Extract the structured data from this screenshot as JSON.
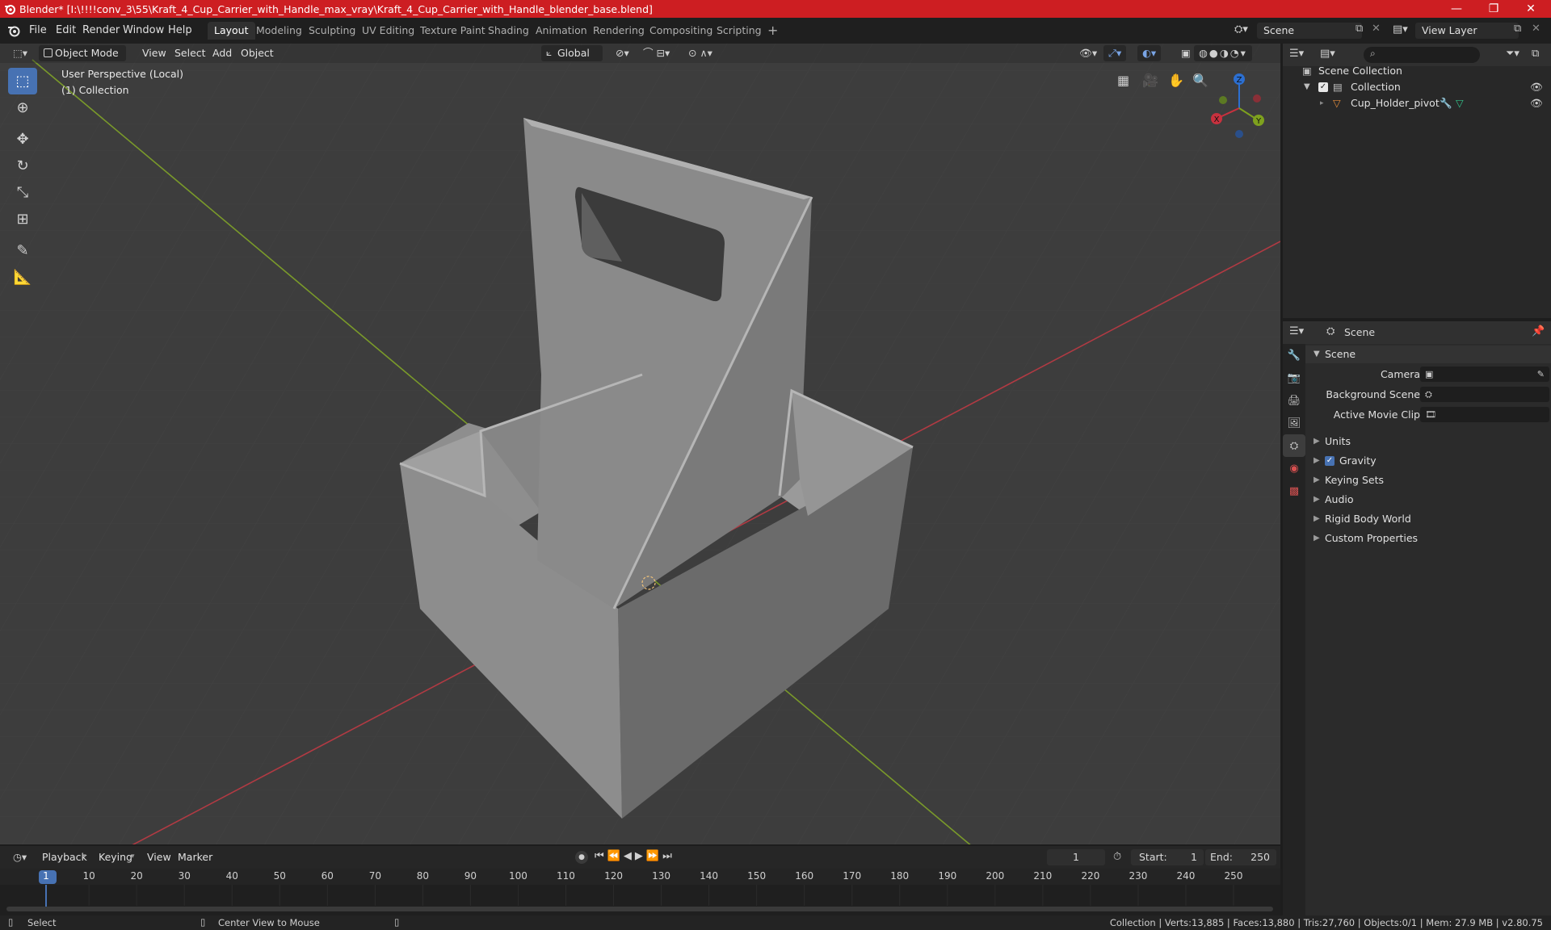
{
  "window": {
    "title": "Blender* [I:\\!!!!conv_3\\55\\Kraft_4_Cup_Carrier_with_Handle_max_vray\\Kraft_4_Cup_Carrier_with_Handle_blender_base.blend]",
    "minimize": "—",
    "maximize": "❐",
    "close": "✕"
  },
  "menu": [
    "File",
    "Edit",
    "Render",
    "Window",
    "Help"
  ],
  "workspaces": [
    {
      "label": "Layout",
      "active": true
    },
    {
      "label": "Modeling"
    },
    {
      "label": "Sculpting"
    },
    {
      "label": "UV Editing"
    },
    {
      "label": "Texture Paint"
    },
    {
      "label": "Shading"
    },
    {
      "label": "Animation"
    },
    {
      "label": "Rendering"
    },
    {
      "label": "Compositing"
    },
    {
      "label": "Scripting"
    }
  ],
  "add_workspace": "+",
  "scene_selector": {
    "value": "Scene"
  },
  "view_layer_selector": {
    "value": "View Layer"
  },
  "viewport": {
    "mode": "Object Mode",
    "menus": [
      "View",
      "Select",
      "Add",
      "Object"
    ],
    "transform_orientation": "Global",
    "perspective_label": "User Perspective (Local)",
    "collection_label": "(1) Collection",
    "gizmo_axes": {
      "x": "X",
      "y": "Y",
      "z": "Z"
    }
  },
  "outliner": {
    "root": "Scene Collection",
    "items": [
      {
        "label": "Collection",
        "level": 1
      },
      {
        "label": "Cup_Holder_pivot",
        "level": 2
      }
    ]
  },
  "properties": {
    "context": "Scene",
    "panel_title": "Scene",
    "fields": [
      {
        "label": "Camera"
      },
      {
        "label": "Background Scene"
      },
      {
        "label": "Active Movie Clip"
      }
    ],
    "sections": [
      {
        "label": "Units"
      },
      {
        "label": "Gravity",
        "checkbox": true
      },
      {
        "label": "Keying Sets"
      },
      {
        "label": "Audio"
      },
      {
        "label": "Rigid Body World"
      },
      {
        "label": "Custom Properties"
      }
    ]
  },
  "timeline": {
    "menus": [
      "Playback",
      "Keying",
      "View",
      "Marker"
    ],
    "current_frame": "1",
    "start_label": "Start:",
    "start": "1",
    "end_label": "End:",
    "end": "250",
    "ticks": [
      "1",
      "10",
      "20",
      "30",
      "40",
      "50",
      "60",
      "70",
      "80",
      "90",
      "100",
      "110",
      "120",
      "130",
      "140",
      "150",
      "160",
      "170",
      "180",
      "190",
      "200",
      "210",
      "220",
      "230",
      "240",
      "250"
    ]
  },
  "statusbar": {
    "left": "Select",
    "middle": "Center View to Mouse",
    "stats": "Collection | Verts:13,885 | Faces:13,880 | Tris:27,760 | Objects:0/1 | Mem: 27.9 MB | v2.80.75"
  },
  "colors": {
    "titlebar": "#cd1e22",
    "accent": "#4772b3",
    "x_axis": "#c8313e",
    "y_axis": "#7ea11e",
    "z_axis": "#2c6fd1"
  }
}
